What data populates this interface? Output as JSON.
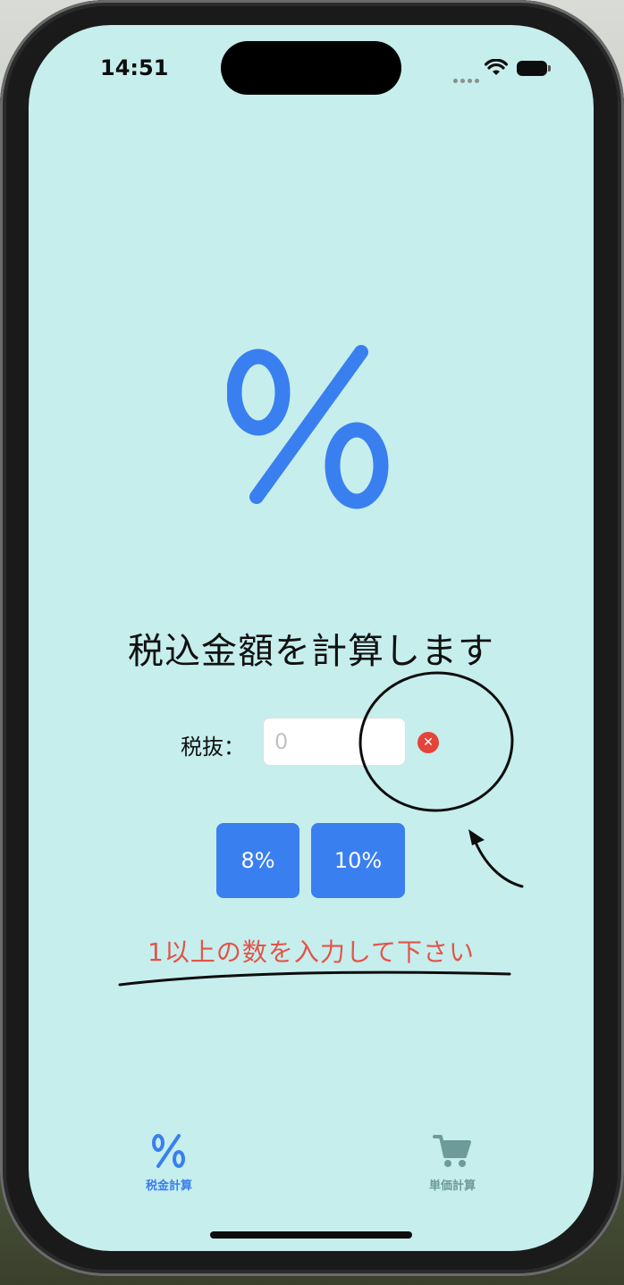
{
  "status_bar": {
    "time": "14:51",
    "icons": [
      "cellular-dots-icon",
      "wifi-icon",
      "battery-icon"
    ]
  },
  "hero": {
    "icon": "percent-icon",
    "color": "#3a7ff0"
  },
  "main": {
    "title": "税込金額を計算します",
    "input": {
      "label": "税抜：",
      "placeholder": "0",
      "value": ""
    },
    "clear_icon": "clear-x-icon",
    "rate_buttons": [
      {
        "label": "8%"
      },
      {
        "label": "10%"
      }
    ],
    "error_message": "1以上の数を入力して下さい",
    "error_color": "#e35447"
  },
  "tab_bar": {
    "items": [
      {
        "label": "税金計算",
        "icon": "percent-icon",
        "selected": true
      },
      {
        "label": "単価計算",
        "icon": "cart-icon",
        "selected": false
      }
    ]
  },
  "colors": {
    "background": "#c6eeed",
    "accent": "#3a7ff0",
    "inactive_tab": "#6e9a9a"
  },
  "annotations": [
    "circle-annotation",
    "arrow-annotation",
    "underline-annotation"
  ]
}
